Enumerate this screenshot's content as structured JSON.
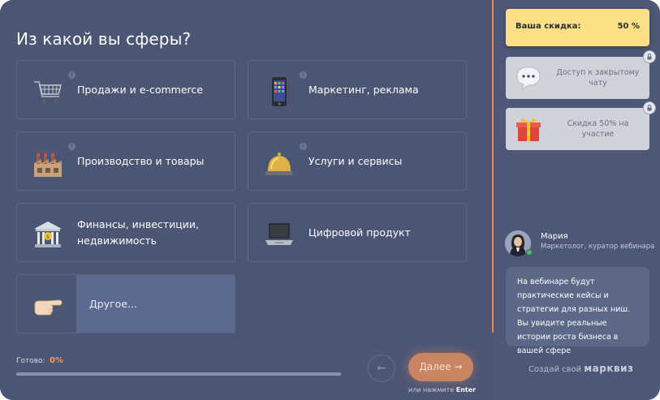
{
  "quiz": {
    "question": "Из какой вы сферы?",
    "options": [
      {
        "label": "Продажи и e-commerce",
        "icon": "shopping-cart-icon"
      },
      {
        "label": "Маркетинг, реклама",
        "icon": "mobile-phone-icon"
      },
      {
        "label": "Производство и товары",
        "icon": "factory-icon"
      },
      {
        "label": "Услуги и сервисы",
        "icon": "service-bell-icon"
      },
      {
        "label": "Финансы, инвестиции, недвижимость",
        "icon": "bank-icon"
      },
      {
        "label": "Цифровой продукт",
        "icon": "laptop-icon"
      }
    ],
    "other": {
      "placeholder": "Другое...",
      "icon": "pointing-hand-icon"
    },
    "info_glyph": "i"
  },
  "progress": {
    "label": "Готово:",
    "value_text": "0%",
    "value": 0
  },
  "nav": {
    "back_glyph": "←",
    "next_label": "Далее →",
    "hint_prefix": "или нажмите",
    "hint_key": "Enter"
  },
  "sidebar": {
    "discount": {
      "label": "Ваша скидка:",
      "value": "50 %"
    },
    "rewards": [
      {
        "text": "Доступ к закрытому чату",
        "icon": "speech-bubble-icon",
        "locked": true
      },
      {
        "text": "Скидка 50% на участие",
        "icon": "gift-icon",
        "locked": true
      }
    ],
    "author": {
      "name": "Мария",
      "role": "Маркетолог, куратор вебинара"
    },
    "message": "На вебинаре будут практические кейсы и стратегии для разных ниш. Вы увидите реальные истории роста бизнеса в вашей сфере",
    "footer": {
      "create": "Создай свой",
      "brand": "марквиз"
    }
  },
  "colors": {
    "accent": "#f29a5e",
    "background": "#4b5675",
    "discount": "#fde086",
    "online": "#3fc164"
  }
}
